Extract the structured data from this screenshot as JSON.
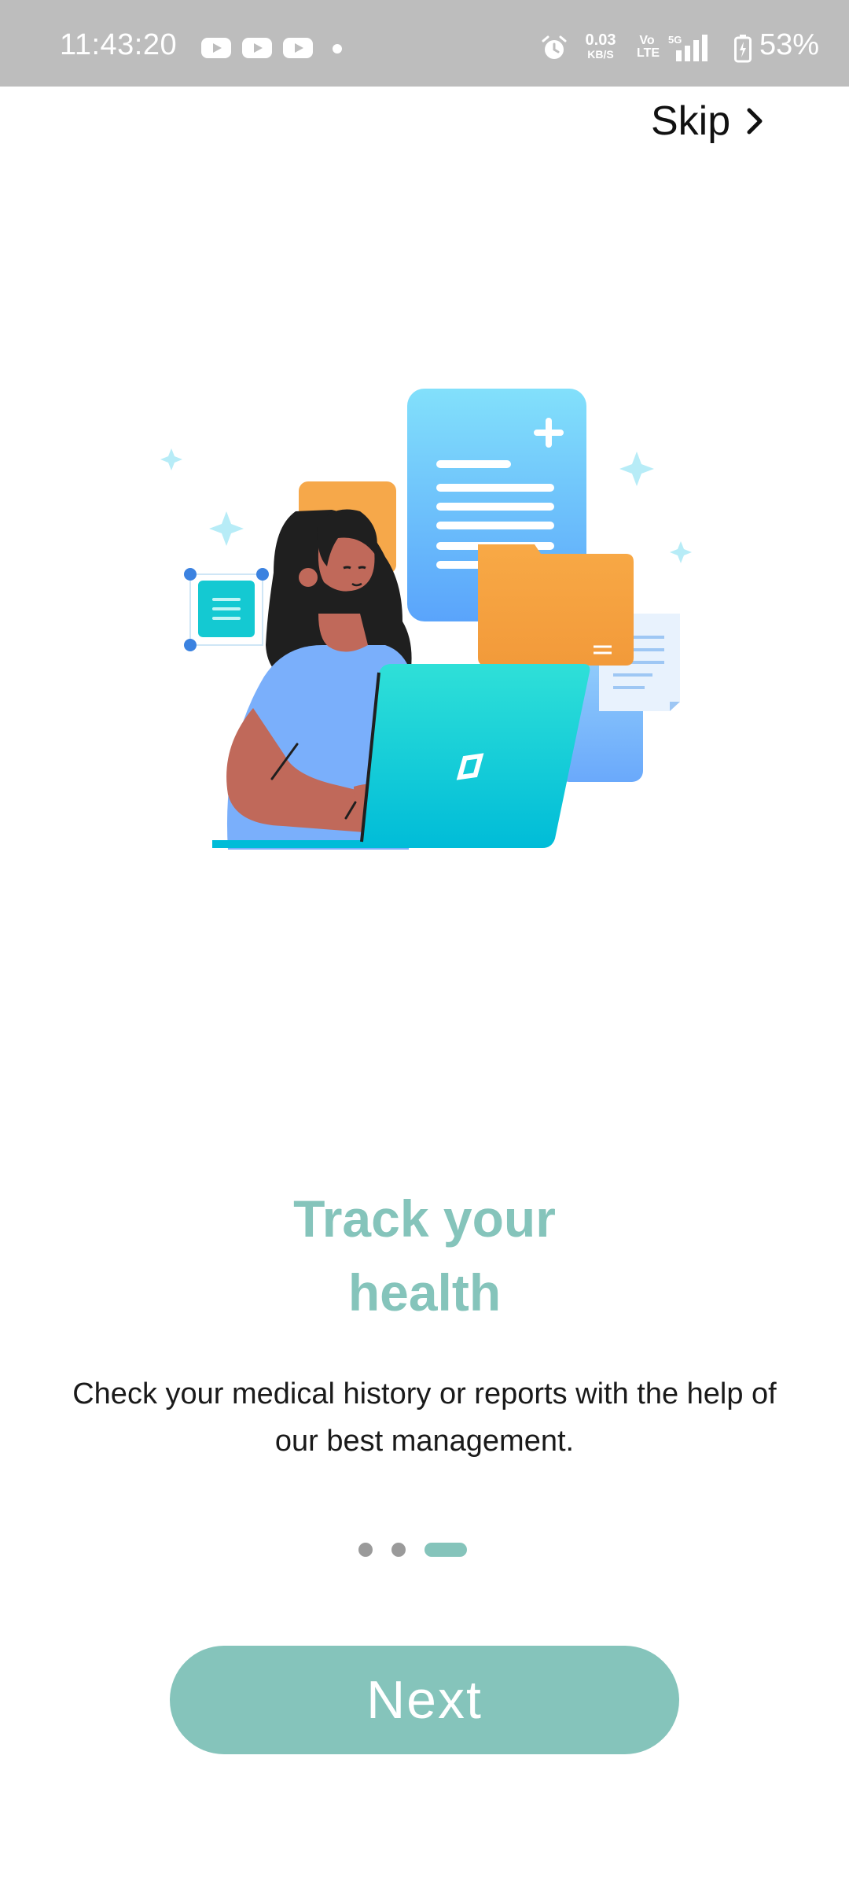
{
  "status_bar": {
    "time": "11:43:20",
    "net_speed": "0.03",
    "net_unit": "KB/S",
    "volte": "Vo LTE",
    "network": "5G",
    "battery": "53%"
  },
  "header": {
    "skip_label": "Skip"
  },
  "onboarding": {
    "title_line1": "Track your",
    "title_line2": "health",
    "description": "Check your medical history or reports with the help of our best management.",
    "page_count": 3,
    "active_page": 3,
    "next_label": "Next"
  },
  "colors": {
    "accent": "#85c4bb",
    "status_bar": "#bdbdbd",
    "inactive_dot": "#9a9a9a"
  }
}
